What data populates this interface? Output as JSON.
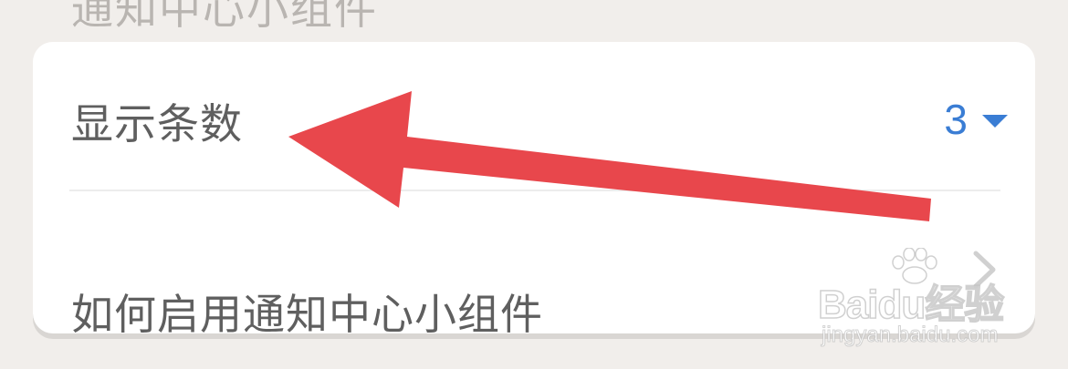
{
  "section": {
    "title": "通知中心小组件"
  },
  "settings": {
    "display_count": {
      "label": "显示条数",
      "value": "3"
    },
    "how_to_enable": {
      "label": "如何启用通知中心小组件"
    }
  },
  "watermark": {
    "brand": "Baidu经验",
    "url": "jingyan.baidu.com"
  },
  "colors": {
    "background": "#f1eeeb",
    "accent": "#3a7dd4",
    "arrow": "#e8474c",
    "label": "#5f5f5f"
  },
  "icons": {
    "dropdown": "caret-down-icon",
    "disclosure": "chevron-right-icon",
    "annotation": "red-arrow-annotation"
  }
}
